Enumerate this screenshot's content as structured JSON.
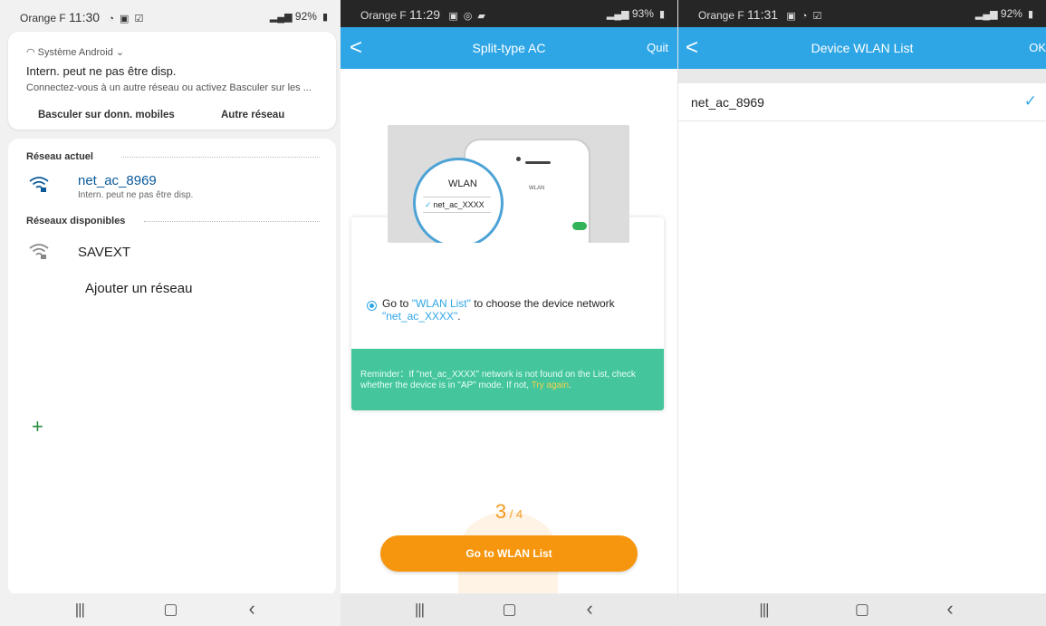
{
  "panel1": {
    "status": {
      "carrier": "Orange F",
      "time": "11:30",
      "battery": "92%"
    },
    "notification": {
      "source": "Système Android",
      "title": "Intern. peut ne pas être disp.",
      "body": "Connectez-vous à un autre réseau ou activez Basculer sur les ...",
      "button_mobile": "Basculer sur donn. mobiles",
      "button_other": "Autre réseau"
    },
    "current_section": "Réseau actuel",
    "current_network": {
      "name": "net_ac_8969",
      "status": "Intern. peut ne pas être disp."
    },
    "available_section": "Réseaux disponibles",
    "available_networks": [
      {
        "name": "SAVEXT"
      }
    ],
    "add_network": "Ajouter un réseau"
  },
  "panel2": {
    "status": {
      "carrier": "Orange F",
      "time": "11:29",
      "battery": "93%"
    },
    "header": {
      "back": "<",
      "title": "Split-type AC",
      "quit": "Quit"
    },
    "illustration": {
      "wlan_label": "WLAN",
      "network_label": "net_ac_XXXX",
      "small_wlan": "WLAN"
    },
    "instruction": {
      "prefix": "Go to ",
      "link": "\"WLAN List\"",
      "middle": " to choose the device network ",
      "network": "\"net_ac_XXXX\"",
      "suffix": "."
    },
    "reminder": {
      "text": "Reminder：If \"net_ac_XXXX\" network is not found on the List, check whether the device is in \"AP\" mode. If not, ",
      "link": "Try again",
      "end": "."
    },
    "step": {
      "current": "3",
      "total": "4"
    },
    "go_button": "Go to WLAN List"
  },
  "panel3": {
    "status": {
      "carrier": "Orange F",
      "time": "11:31",
      "battery": "92%"
    },
    "header": {
      "back": "<",
      "title": "Device WLAN List",
      "ok": "OK"
    },
    "networks": [
      {
        "name": "net_ac_8969",
        "selected": true
      }
    ]
  },
  "colors": {
    "accent_blue": "#2ea6e6",
    "reminder_green": "#45c59c",
    "button_orange": "#f6960f"
  }
}
